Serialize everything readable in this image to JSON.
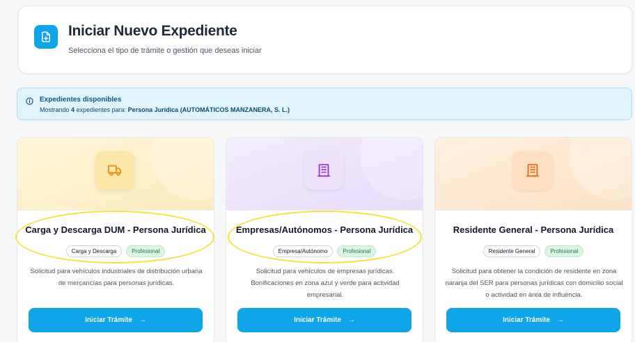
{
  "header": {
    "title": "Iniciar Nuevo Expediente",
    "subtitle": "Selecciona el tipo de trámite o gestión que deseas iniciar",
    "icon": "file-plus-icon"
  },
  "info": {
    "icon": "info-icon",
    "title": "Expedientes disponibles",
    "text_prefix": "Mostrando",
    "count": "4",
    "text_middle": "expedientes para:",
    "entity": "Persona Jurídica (AUTOMÁTICOS MANZANERA, S. L.)"
  },
  "cards": [
    {
      "icon": "truck-icon",
      "icon_color": "#ea8a18",
      "title": "Carga y Descarga DUM - Persona Jurídica",
      "tag_category": "Carga y Descarga",
      "tag_profile": "Profesional",
      "description": "Solicitud para vehículos industriales de distribución urbana de mercancías para personas jurídicas.",
      "button_label": "Iniciar Trámite",
      "button_icon": "arrow-right-icon"
    },
    {
      "icon": "building-icon",
      "icon_color": "#9333ea",
      "title": "Empresas/Autónomos - Persona Jurídica",
      "tag_category": "Empresa/Autónomo",
      "tag_profile": "Profesional",
      "description": "Solicitud para vehículos de empresas jurídicas. Bonificaciones en zona azul y verde para actividad empresarial.",
      "button_label": "Iniciar Trámite",
      "button_icon": "arrow-right-icon"
    },
    {
      "icon": "building-icon",
      "icon_color": "#ea6a18",
      "title": "Residente General - Persona Jurídica",
      "tag_category": "Residente General",
      "tag_profile": "Profesional",
      "description": "Solicitud para obtener la condición de residente en zona naranja del SER para personas jurídicas con domicilio social o actividad en área de influencia.",
      "button_label": "Iniciar Trámite",
      "button_icon": "arrow-right-icon"
    }
  ],
  "colors": {
    "primary": "#0ea5e9",
    "highlight": "#f5e23a"
  }
}
